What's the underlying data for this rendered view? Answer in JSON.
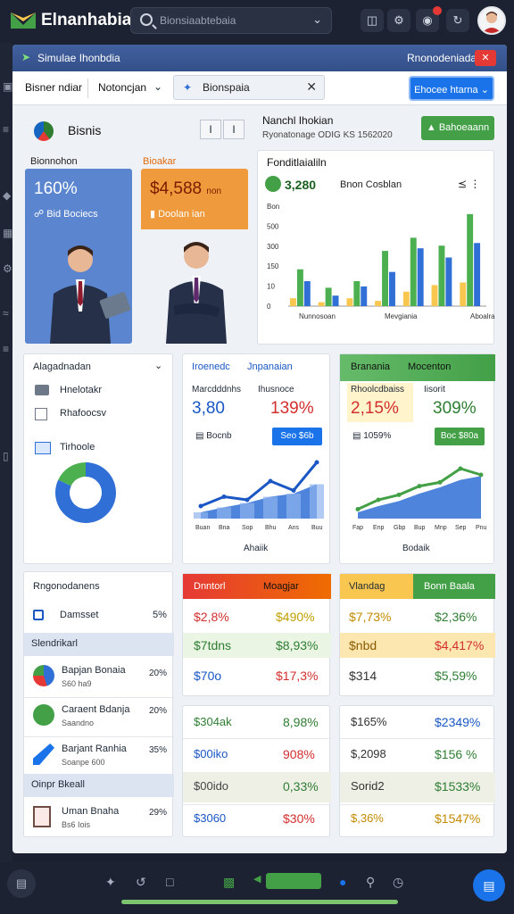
{
  "app": {
    "title": "Elnanhabia",
    "search_placeholder": "Bionsiaabtebaia"
  },
  "topbar": {
    "icons": [
      "folder-icon",
      "settings-icon",
      "notifications-icon",
      "refresh-icon"
    ]
  },
  "window": {
    "title": "Simulae Ihonbdia",
    "right_label": "Rnonodeniadaf",
    "close_label": "✕"
  },
  "tabs": {
    "items": [
      "Bisner ndiar",
      "Notoncjan"
    ],
    "active": "Bionspaia",
    "primary_button": "Ehocee htarna"
  },
  "business": {
    "title": "Bisnis",
    "pager": [
      "I",
      "I"
    ],
    "tile1": {
      "label": "Bionnohon",
      "value": "160%",
      "caption": "Bid Bociecs",
      "color": "#5b86cf"
    },
    "tile2": {
      "label": "Bioakar",
      "value": "$4,588",
      "unit": "non",
      "caption": "Doolan ian",
      "color": "#ef9a3c"
    }
  },
  "revenue": {
    "title": "Nanchl Ihokian",
    "subtitle": "Ryonatonage ODIG KS 1562020",
    "button": "Bahoeaann"
  },
  "chart_data": {
    "type": "bar",
    "title": "Fonditlaialiln",
    "kpi_value": "3,280",
    "kpi_label": "Bnon Cosblan",
    "more": "⪯ ⋮",
    "y_tick_labels": [
      "Bon",
      "500",
      "300",
      "150",
      "10",
      "0"
    ],
    "x_tick_labels": [
      "Nunnosoan",
      "Mevgiania",
      "Aboalran"
    ],
    "series": [
      {
        "color": "#f9c74f",
        "values": [
          30,
          15,
          30,
          20,
          55,
          80,
          90
        ]
      },
      {
        "color": "#4caf50",
        "values": [
          140,
          70,
          95,
          210,
          260,
          230,
          350
        ]
      },
      {
        "color": "#2f6fd6",
        "values": [
          95,
          40,
          75,
          130,
          220,
          185,
          240
        ]
      }
    ],
    "ylim": [
      0,
      380
    ]
  },
  "left_panel": {
    "title": "Alagadnadan",
    "items": [
      {
        "icon": "wallet-icon",
        "label": "Hnelotakr"
      },
      {
        "icon": "document-icon",
        "label": "Rhafoocsv"
      },
      {
        "icon": "chart-icon",
        "label": "Tirhoole"
      }
    ],
    "donut": [
      {
        "value": 82,
        "color": "#2f6fd6"
      },
      {
        "value": 18,
        "color": "#4caf50"
      }
    ]
  },
  "card_blue": {
    "tabs": [
      "Iroenedc",
      "Jnpanaian"
    ],
    "col1_label": "Marcdddnhs",
    "col1_value": "3,80",
    "col2_label": "Ihusnoce",
    "col2_value": "139%",
    "caption": "Bocnb",
    "button": "Seo $6b",
    "footer": "Ahaiik",
    "x_labels": [
      "Buan",
      "Bna",
      "Sop",
      "Bhu",
      "Ans",
      "Buu"
    ],
    "line": [
      20,
      35,
      30,
      60,
      45,
      90
    ],
    "area": [
      10,
      18,
      25,
      35,
      40,
      55
    ]
  },
  "card_green": {
    "tabs": [
      "Branania",
      "Mocenton"
    ],
    "col1_label": "Rhoolcdbaiss",
    "col1_value": "2,15%",
    "col2_label": "Iisorit",
    "col2_value": "309%",
    "caption": "1059%",
    "button": "Boc $80a",
    "footer": "Bodaik",
    "x_labels": [
      "Fap",
      "Enp",
      "Gbp",
      "Bup",
      "Mnp",
      "Sep",
      "Pnu"
    ],
    "line": [
      15,
      30,
      38,
      52,
      58,
      80,
      70
    ],
    "area": [
      10,
      20,
      28,
      40,
      50,
      62,
      68
    ]
  },
  "left_table": {
    "title": "Rngonodanens",
    "summary_label": "Damsset",
    "summary_value": "5%",
    "group1": "Slendrikarl",
    "rows1": [
      {
        "title": "Bapjan Bonaia",
        "sub": "S60 ha9",
        "pct": "20%"
      },
      {
        "title": "Caraent Bdanja",
        "sub": "Saandno",
        "pct": "20%"
      },
      {
        "title": "Barjant Ranhia",
        "sub": "Soanpe 600",
        "pct": "35%"
      }
    ],
    "group2": "Oinpr Bkeall",
    "rows2": [
      {
        "title": "Uman Bnaha",
        "sub": "Bs6 Iois",
        "pct": "29%"
      }
    ]
  },
  "mid_table_top": {
    "headers": [
      "Dnntorl",
      "Moagjar"
    ],
    "rows": [
      [
        "$2,8%",
        "$490%"
      ],
      [
        "$7tdns",
        "$8,93%"
      ],
      [
        "$70o",
        "$17,3%"
      ]
    ]
  },
  "right_table_top": {
    "headers": [
      "Vlandag",
      "Bonn Baala"
    ],
    "rows": [
      [
        "$7,73%",
        "$2,36%"
      ],
      [
        "$nbd",
        "$4,417%"
      ],
      [
        "$314",
        "$5,59%"
      ]
    ]
  },
  "mid_table_bottom": {
    "rows": [
      [
        "$304ak",
        "8,98%"
      ],
      [
        "$00iko",
        "908%"
      ],
      [
        "$00ido",
        "0,33%"
      ],
      [
        "$3060",
        "$30%"
      ]
    ]
  },
  "right_table_bottom": {
    "rows": [
      [
        "$165%",
        "$2349%"
      ],
      [
        "$,2098",
        "$156 %"
      ],
      [
        "Sorid2",
        "$1533%"
      ],
      [
        "$,36%",
        "$1547%"
      ]
    ]
  },
  "bottom_bar": {
    "icons": [
      "home-icon",
      "bolt-icon",
      "copy-icon",
      "list-icon",
      "chat-icon",
      "shield-icon",
      "edit-icon",
      "clock-icon",
      "save-icon"
    ]
  },
  "colors": {
    "accent_blue": "#1a73e8",
    "accent_green": "#43a047",
    "accent_red": "#e53935",
    "accent_orange": "#ef9a3c"
  }
}
